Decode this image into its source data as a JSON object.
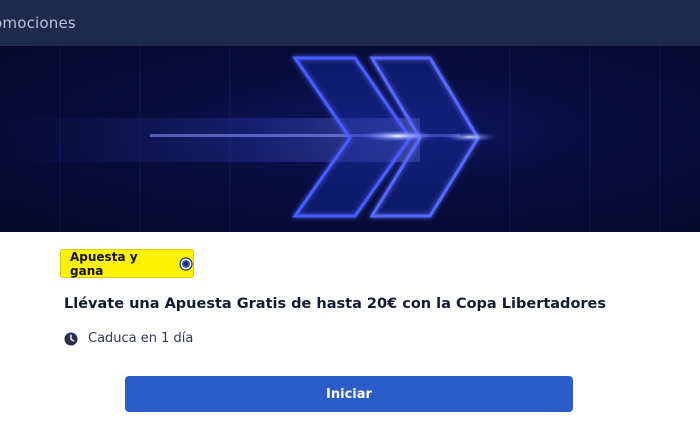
{
  "header": {
    "title": "omociones"
  },
  "banner": {
    "image": "double-chevron-arrow-graphic",
    "colors": {
      "background": "#060b35",
      "glow": "#3a4dff"
    }
  },
  "promo": {
    "badge_label": "Apuesta y gana",
    "badge_icon": "soccer-ball-icon",
    "title": "Llévate una Apuesta Gratis de hasta 20€ con la Copa Libertadores",
    "expiry_icon": "clock-icon",
    "expiry_text": "Caduca en 1 día",
    "cta_label": "Iniciar"
  },
  "colors": {
    "header_bg": "#1d2a4d",
    "badge_bg": "#fff200",
    "button_bg": "#2c5cc8"
  }
}
